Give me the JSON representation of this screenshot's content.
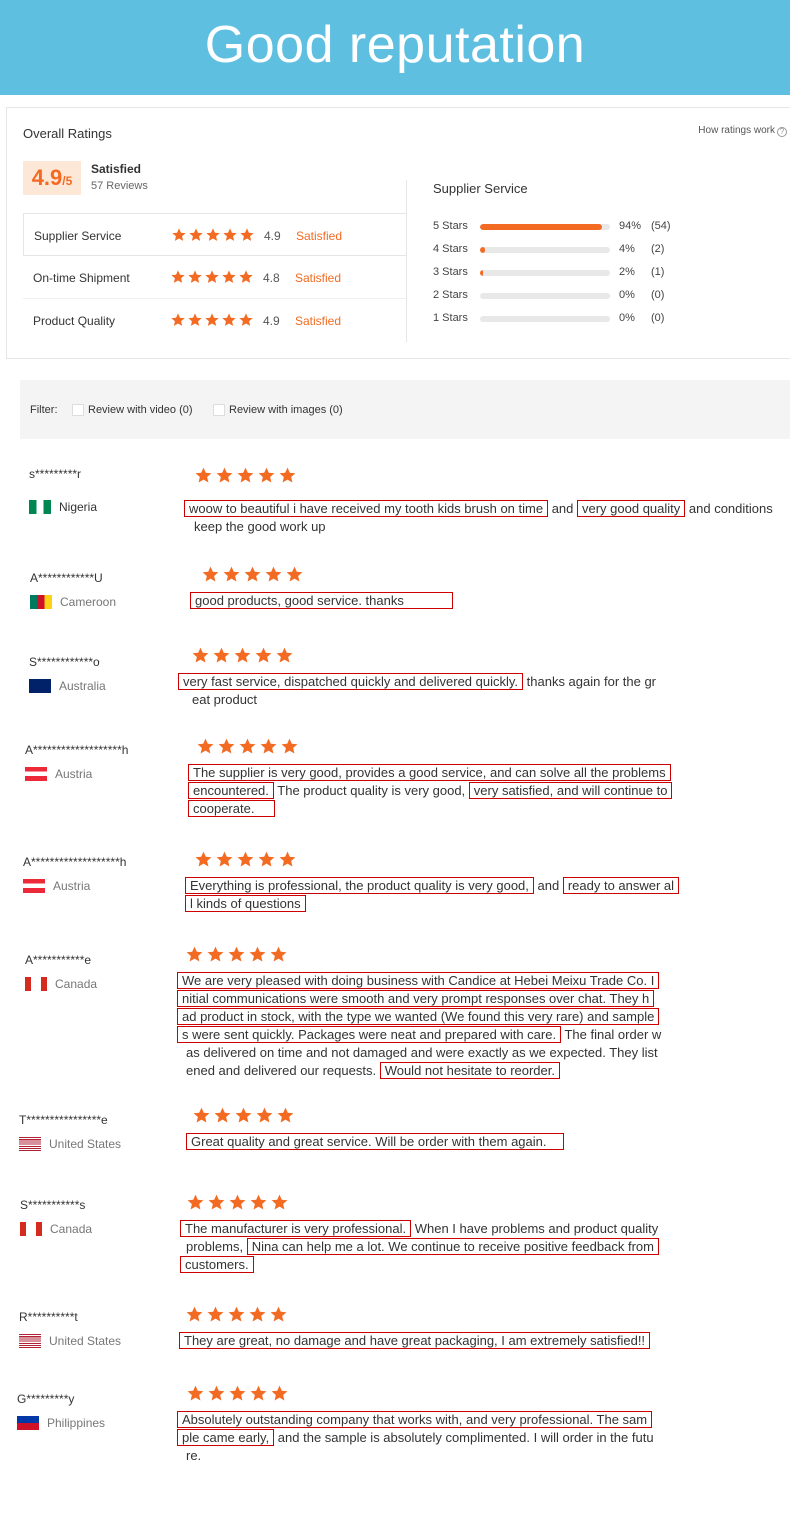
{
  "banner": {
    "title": "Good reputation"
  },
  "overall": {
    "title": "Overall Ratings",
    "how_link": "How ratings work",
    "score": "4.9",
    "score_suffix": "/5",
    "label": "Satisfied",
    "reviews": "57 Reviews",
    "metrics": [
      {
        "label": "Supplier Service",
        "score": "4.9",
        "status": "Satisfied"
      },
      {
        "label": "On-time Shipment",
        "score": "4.8",
        "status": "Satisfied"
      },
      {
        "label": "Product Quality",
        "score": "4.9",
        "status": "Satisfied"
      }
    ]
  },
  "supplier_service": {
    "title": "Supplier Service",
    "rows": [
      {
        "label": "5 Stars",
        "percent": "94%",
        "count": "(54)",
        "fraction": 0.94
      },
      {
        "label": "4 Stars",
        "percent": "4%",
        "count": "(2)",
        "fraction": 0.04
      },
      {
        "label": "3 Stars",
        "percent": "2%",
        "count": "(1)",
        "fraction": 0.02
      },
      {
        "label": "2 Stars",
        "percent": "0%",
        "count": "(0)",
        "fraction": 0
      },
      {
        "label": "1 Stars",
        "percent": "0%",
        "count": "(0)",
        "fraction": 0
      }
    ]
  },
  "filter": {
    "label": "Filter:",
    "option_video": "Review with video (0)",
    "option_images": "Review with images (0)"
  },
  "reviews": [
    {
      "name": "s*********r",
      "country": "Nigeria",
      "stars": 5,
      "line1a": "woow to beautiful i have received my tooth kids brush on time",
      "line1b": " and ",
      "line1c": "very good quality",
      "line1d": " and conditions",
      "line2": "keep the good work up"
    },
    {
      "name": "A************U",
      "country": "Cameroon",
      "stars": 5,
      "text": "good products, good service. thanks"
    },
    {
      "name": "S************o",
      "country": "Australia",
      "stars": 5,
      "line1a": "very fast service, dispatched quickly and delivered quickly.",
      "line1b": " thanks again for the gr",
      "line2": "eat product"
    },
    {
      "name": "A*******************h",
      "country": "Austria",
      "stars": 5,
      "line1": "The supplier is very good, provides a good service, and can solve all the problems",
      "line2a": "encountered.",
      "line2b": " The product quality is very good, ",
      "line2c": "very satisfied, and will continue to",
      "line3": "cooperate."
    },
    {
      "name": "A*******************h",
      "country": "Austria",
      "stars": 5,
      "line1a": "Everything is professional, the product quality is very good,",
      "line1b": " and ",
      "line1c": "ready to answer al",
      "line2": "l kinds of questions"
    },
    {
      "name": "A***********e",
      "country": "Canada",
      "stars": 5,
      "line1": "We are very pleased with doing business with Candice at Hebei Meixu Trade Co. I",
      "line2": "nitial communications were smooth and very prompt responses over chat. They h",
      "line3": "ad product in stock, with the type we wanted (We found this very rare) and sample",
      "line4a": "s were sent quickly. Packages were neat and prepared with care.",
      "line4b": " The final order w",
      "line5": "as delivered on time and not damaged and were exactly as we expected. They list",
      "line6a": "ened and delivered our requests. ",
      "line6b": "Would not hesitate to reorder."
    },
    {
      "name": "T****************e",
      "country": "United States",
      "stars": 5,
      "text": "Great quality and great service. Will be order with them again."
    },
    {
      "name": "S***********s",
      "country": "Canada",
      "stars": 5,
      "line1a": "The manufacturer is very professional.",
      "line1b": " When I have problems and product quality",
      "line2a": "problems, ",
      "line2b": "Nina can help me a lot. We continue to receive positive feedback from",
      "line3": "customers."
    },
    {
      "name": "R**********t",
      "country": "United States",
      "stars": 5,
      "text": "They are great, no damage and have great packaging, I am extremely satisfied!!"
    },
    {
      "name": "G*********y",
      "country": "Philippines",
      "stars": 5,
      "line1": "Absolutely outstanding company that works with, and very professional. The sam",
      "line2a": "ple came early,",
      "line2b": " and the sample is absolutely complimented. I will order in the futu",
      "line3": "re."
    }
  ],
  "colors": {
    "banner": "#5ebfe0",
    "accent": "#f36b23",
    "highlight_box": "#cc0000"
  },
  "icons": {
    "star": "star-icon",
    "help": "question-circle-icon"
  }
}
